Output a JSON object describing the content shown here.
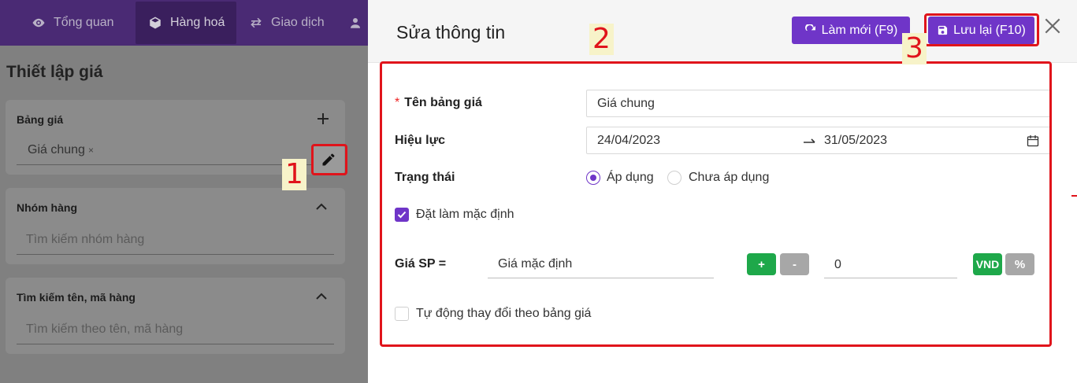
{
  "nav": {
    "items": [
      {
        "label": "Tổng quan",
        "icon": "eye-icon"
      },
      {
        "label": "Hàng hoá",
        "icon": "box-icon"
      },
      {
        "label": "Giao dịch",
        "icon": "swap-icon"
      }
    ]
  },
  "page": {
    "title": "Thiết lập giá"
  },
  "price_list_card": {
    "title": "Bảng giá",
    "tag": "Giá chung",
    "tag_remove": "×"
  },
  "group_card": {
    "title": "Nhóm hàng",
    "placeholder": "Tìm kiếm nhóm hàng"
  },
  "search_card": {
    "title": "Tìm kiếm tên, mã hàng",
    "placeholder": "Tìm kiếm theo tên, mã hàng"
  },
  "modal": {
    "title": "Sửa thông tin",
    "refresh_label": "Làm mới (F9)",
    "save_label": "Lưu lại (F10)",
    "fields": {
      "name_label": "Tên bảng giá",
      "name_required": "*",
      "name_value": "Giá chung",
      "validity_label": "Hiệu lực",
      "date_from": "24/04/2023",
      "date_to": "31/05/2023",
      "status_label": "Trạng thái",
      "status_opt_apply": "Áp dụng",
      "status_opt_not_apply": "Chưa áp dụng",
      "default_label": "Đặt làm mặc định",
      "price_label": "Giá SP =",
      "price_base": "Giá mặc định",
      "plus": "+",
      "minus": "-",
      "amount": "0",
      "unit_vnd": "VND",
      "unit_pct": "%",
      "auto_label": "Tự động thay đổi theo bảng giá"
    }
  },
  "annotations": {
    "one": "1",
    "two": "2",
    "three": "3"
  },
  "colors": {
    "accent": "#6f35c8",
    "green": "#1ea84a",
    "annotation": "#e0141b"
  }
}
